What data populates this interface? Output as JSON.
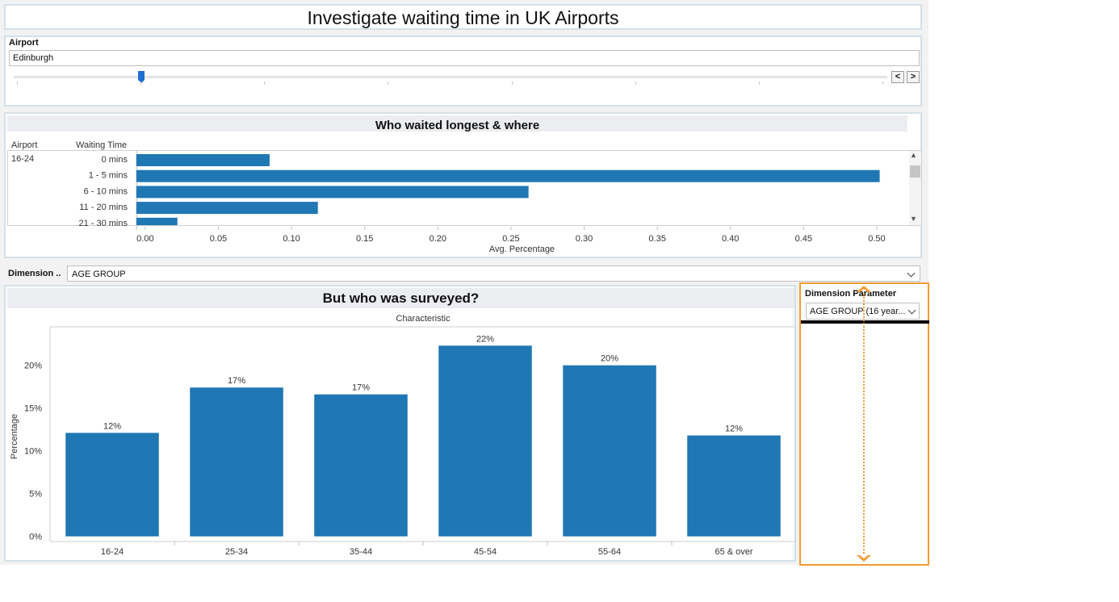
{
  "dashboard": {
    "title": "Investigate waiting time in UK Airports"
  },
  "airport_filter": {
    "label": "Airport",
    "value": "Edinburgh",
    "slider_level": 0.146,
    "prev_glyph": "<",
    "next_glyph": ">"
  },
  "wait_chart": {
    "title": "Who waited longest & where",
    "col_airport": "Airport",
    "col_waiting": "Waiting Time",
    "airport_value": "16-24",
    "axis_title": "Avg. Percentage",
    "scroll_up_glyph": "▲",
    "scroll_down_glyph": "▼"
  },
  "dimension": {
    "label": "Dimension ..",
    "value": "AGE GROUP"
  },
  "survey_chart": {
    "title": "But who was surveyed?",
    "subtitle": "Characteristic",
    "ylabel": "Percentage",
    "ytick_labels": [
      "0%",
      "5%",
      "10%",
      "15%",
      "20%"
    ]
  },
  "parameter": {
    "label": "Dimension Parameter",
    "value": "AGE GROUP (16 year...",
    "accent_color": "#f39c34"
  },
  "colors": {
    "bar": "#1f77b4",
    "highlight": "#f39c34",
    "header_bg": "#ebedf0"
  },
  "chart_data": [
    {
      "type": "bar",
      "orientation": "horizontal",
      "title": "Who waited longest & where",
      "categories": [
        "0 mins",
        "1 - 5 mins",
        "6 - 10 mins",
        "11 - 20 mins",
        "21 - 30 mins"
      ],
      "values": [
        0.085,
        0.502,
        0.262,
        0.118,
        0.022
      ],
      "xlabel": "Avg. Percentage",
      "xlim": [
        -0.006,
        0.521
      ],
      "xticks": [
        0,
        0.05,
        0.1,
        0.15,
        0.2,
        0.25,
        0.3,
        0.35,
        0.4,
        0.45,
        0.5
      ],
      "xtick_labels": [
        "0.00",
        "0.05",
        "0.10",
        "0.15",
        "0.20",
        "0.25",
        "0.30",
        "0.35",
        "0.40",
        "0.45",
        "0.50"
      ]
    },
    {
      "type": "bar",
      "title": "But who was surveyed?",
      "subtitle": "Characteristic",
      "categories": [
        "16-24",
        "25-34",
        "35-44",
        "45-54",
        "55-64",
        "65 & over"
      ],
      "values": [
        12.1,
        17.4,
        16.6,
        22.3,
        20.0,
        11.8
      ],
      "data_labels": [
        "12%",
        "17%",
        "17%",
        "22%",
        "20%",
        "12%"
      ],
      "ylabel": "Percentage",
      "ylim": [
        -0.6,
        24.5
      ],
      "yticks": [
        0,
        5,
        10,
        15,
        20
      ]
    }
  ]
}
